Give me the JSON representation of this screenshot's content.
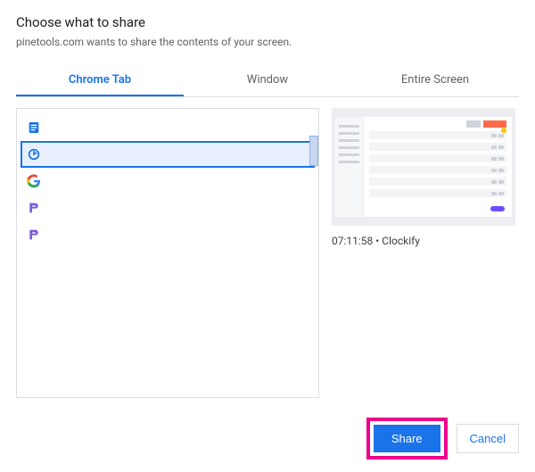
{
  "header": {
    "title": "Choose what to share",
    "subtitle": "pinetools.com wants to share the contents of your screen."
  },
  "tabs": [
    {
      "label": "Chrome Tab",
      "active": true
    },
    {
      "label": "Window",
      "active": false
    },
    {
      "label": "Entire Screen",
      "active": false
    }
  ],
  "tab_items": [
    {
      "icon": "doc-icon",
      "selected": false
    },
    {
      "icon": "clockify-icon",
      "selected": true
    },
    {
      "icon": "google-icon",
      "selected": false
    },
    {
      "icon": "app-purple-icon",
      "selected": false
    },
    {
      "icon": "app-purple-icon",
      "selected": false
    }
  ],
  "preview": {
    "caption": "07:11:58 • Clockify"
  },
  "footer": {
    "share_label": "Share",
    "cancel_label": "Cancel"
  }
}
